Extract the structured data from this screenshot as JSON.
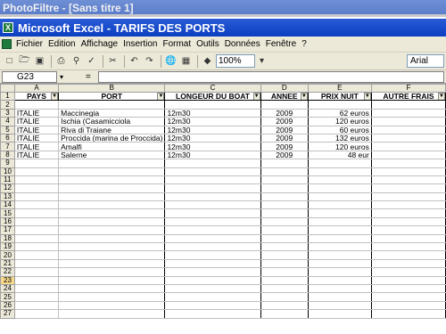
{
  "back_window": {
    "title": "PhotoFiltre - [Sans titre 1]"
  },
  "window": {
    "title": "Microsoft Excel - TARIFS DES PORTS",
    "icon": "excel-icon"
  },
  "menu": [
    "Fichier",
    "Edition",
    "Affichage",
    "Insertion",
    "Format",
    "Outils",
    "Données",
    "Fenêtre",
    "?"
  ],
  "toolbar": {
    "zoom": "100%",
    "font": "Arial"
  },
  "formula_bar": {
    "cell_ref": "G23",
    "eq": "=",
    "value": ""
  },
  "columns": [
    "A",
    "B",
    "C",
    "D",
    "E",
    "F"
  ],
  "headers": [
    "PAYS",
    "PORT",
    "LONGEUR DU BOAT",
    "ANNEE",
    "PRIX NUIT",
    "AUTRE FRAIS"
  ],
  "rows": [
    [
      "ITALIE",
      "Maccinegia",
      "12m30",
      "2009",
      "62 euros",
      ""
    ],
    [
      "ITALIE",
      "Ischia (Casamicciola",
      "12m30",
      "2009",
      "120 euros",
      ""
    ],
    [
      "ITALIE",
      "Riva di Traiane",
      "12m30",
      "2009",
      "60 euros",
      ""
    ],
    [
      "ITALIE",
      "Proccida (marina de Proccida)",
      "12m30",
      "2009",
      "132 euros",
      ""
    ],
    [
      "ITALIE",
      "Amalfi",
      "12m30",
      "2009",
      "120 euros",
      ""
    ],
    [
      "ITALIE",
      "Salerne",
      "12m30",
      "2009",
      "48 eur",
      ""
    ]
  ],
  "row_numbers": [
    "1",
    "2",
    "3",
    "4",
    "5",
    "6",
    "7",
    "8",
    "9",
    "10",
    "11",
    "12",
    "13",
    "14",
    "15",
    "16",
    "17",
    "18",
    "19",
    "20",
    "21",
    "22",
    "23",
    "24",
    "25",
    "26",
    "27"
  ],
  "active_row": "23"
}
